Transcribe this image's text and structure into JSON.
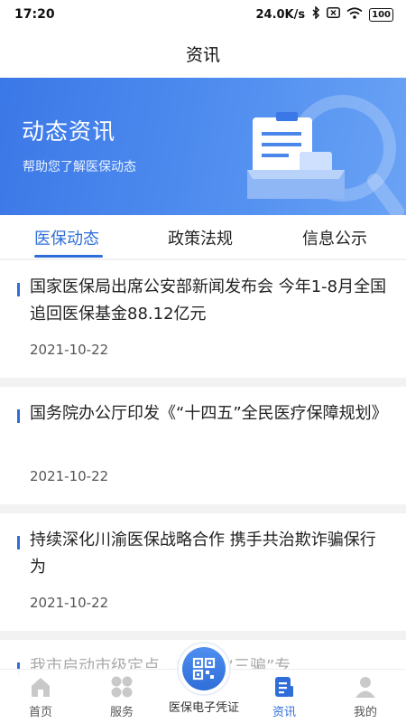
{
  "status_bar": {
    "time": "17:20",
    "network_speed": "24.0K/s",
    "battery": "100"
  },
  "nav": {
    "title": "资讯"
  },
  "banner": {
    "title": "动态资讯",
    "subtitle": "帮助您了解医保动态"
  },
  "tabs": [
    {
      "label": "医保动态",
      "active": true
    },
    {
      "label": "政策法规",
      "active": false
    },
    {
      "label": "信息公示",
      "active": false
    }
  ],
  "news": [
    {
      "title": "国家医保局出席公安部新闻发布会 今年1-8月全国追回医保基金88.12亿元",
      "date": "2021-10-22"
    },
    {
      "title": "国务院办公厅印发《“十四五”全民医疗保障规划》",
      "date": "2021-10-22"
    },
    {
      "title": "持续深化川渝医保战略合作 携手共治欺诈骗保行为",
      "date": "2021-10-22"
    },
    {
      "title": "我市启动市级定点…“三假”“三骗”专…",
      "date": ""
    }
  ],
  "tabbar": {
    "items": [
      {
        "label": "首页",
        "icon": "home-icon",
        "active": false
      },
      {
        "label": "服务",
        "icon": "grid-icon",
        "active": false
      },
      {
        "label": "资讯",
        "icon": "news-icon",
        "active": true
      },
      {
        "label": "我的",
        "icon": "person-icon",
        "active": false
      }
    ],
    "center": {
      "label": "医保电子凭证",
      "icon": "qr-code-icon"
    }
  },
  "colors": {
    "primary": "#2f6ed8",
    "banner_start": "#3b78e7",
    "banner_end": "#6aa3f5"
  }
}
